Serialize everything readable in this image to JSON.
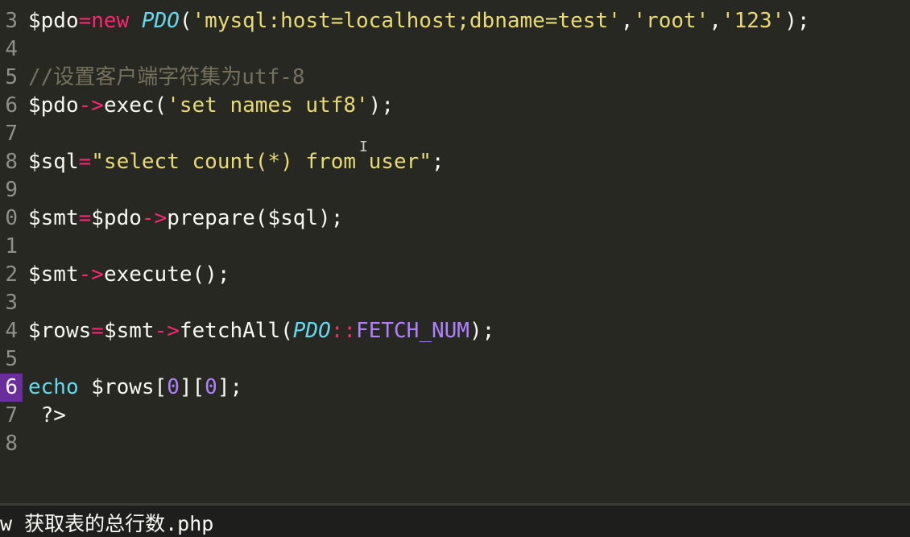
{
  "editor": {
    "active_line": "6",
    "lines": [
      {
        "num": "3",
        "tokens": [
          {
            "t": "$pdo",
            "c": "var"
          },
          {
            "t": "=",
            "c": "op"
          },
          {
            "t": "new",
            "c": "kw"
          },
          {
            "t": " ",
            "c": "p"
          },
          {
            "t": "PDO",
            "c": "cls"
          },
          {
            "t": "(",
            "c": "p"
          },
          {
            "t": "'mysql:host=localhost;dbname=test'",
            "c": "str"
          },
          {
            "t": ",",
            "c": "p"
          },
          {
            "t": "'root'",
            "c": "str"
          },
          {
            "t": ",",
            "c": "p"
          },
          {
            "t": "'123'",
            "c": "str"
          },
          {
            "t": ");",
            "c": "p"
          }
        ]
      },
      {
        "num": "4",
        "tokens": []
      },
      {
        "num": "5",
        "tokens": [
          {
            "t": "//设置客户端字符集为utf-8",
            "c": "com"
          }
        ]
      },
      {
        "num": "6",
        "tokens": [
          {
            "t": "$pdo",
            "c": "var"
          },
          {
            "t": "->",
            "c": "op"
          },
          {
            "t": "exec(",
            "c": "p"
          },
          {
            "t": "'set names utf8'",
            "c": "str"
          },
          {
            "t": ");",
            "c": "p"
          }
        ]
      },
      {
        "num": "7",
        "tokens": []
      },
      {
        "num": "8",
        "tokens": [
          {
            "t": "$sql",
            "c": "var"
          },
          {
            "t": "=",
            "c": "op"
          },
          {
            "t": "\"select count(*) from user\"",
            "c": "str"
          },
          {
            "t": ";",
            "c": "p"
          }
        ]
      },
      {
        "num": "9",
        "tokens": []
      },
      {
        "num": "0",
        "tokens": [
          {
            "t": "$smt",
            "c": "var"
          },
          {
            "t": "=",
            "c": "op"
          },
          {
            "t": "$pdo",
            "c": "var"
          },
          {
            "t": "->",
            "c": "op"
          },
          {
            "t": "prepare($sql);",
            "c": "p"
          }
        ]
      },
      {
        "num": "1",
        "tokens": []
      },
      {
        "num": "2",
        "tokens": [
          {
            "t": "$smt",
            "c": "var"
          },
          {
            "t": "->",
            "c": "op"
          },
          {
            "t": "execute();",
            "c": "p"
          }
        ]
      },
      {
        "num": "3",
        "tokens": []
      },
      {
        "num": "4",
        "tokens": [
          {
            "t": "$rows",
            "c": "var"
          },
          {
            "t": "=",
            "c": "op"
          },
          {
            "t": "$smt",
            "c": "var"
          },
          {
            "t": "->",
            "c": "op"
          },
          {
            "t": "fetchAll(",
            "c": "p"
          },
          {
            "t": "PDO",
            "c": "cls"
          },
          {
            "t": "::",
            "c": "op"
          },
          {
            "t": "FETCH_NUM",
            "c": "const"
          },
          {
            "t": ");",
            "c": "p"
          }
        ]
      },
      {
        "num": "5",
        "tokens": []
      },
      {
        "num": "6",
        "tokens": [
          {
            "t": "echo",
            "c": "ech"
          },
          {
            "t": " $rows[",
            "c": "p"
          },
          {
            "t": "0",
            "c": "num"
          },
          {
            "t": "][",
            "c": "p"
          },
          {
            "t": "0",
            "c": "num"
          },
          {
            "t": "];",
            "c": "p"
          }
        ]
      },
      {
        "num": "7",
        "tokens": [
          {
            "t": " ?>",
            "c": "p"
          }
        ]
      },
      {
        "num": "8",
        "tokens": []
      }
    ]
  },
  "text_cursor_glyph": "I",
  "statusbar": {
    "text": "w 获取表的总行数.php"
  },
  "colors": {
    "background": "#272822",
    "keyword": "#f92672",
    "string": "#e6db74",
    "comment": "#75715e",
    "class": "#66d9ef",
    "number": "#ae81ff",
    "active_gutter": "#6a2d9c"
  }
}
